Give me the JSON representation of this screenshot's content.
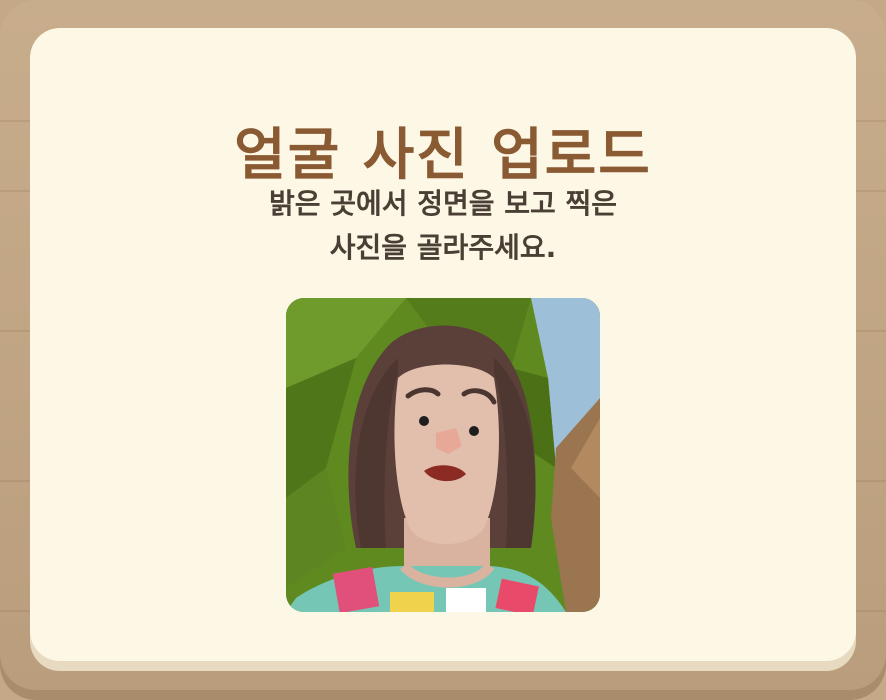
{
  "dialog": {
    "title": "얼굴 사진 업로드",
    "description_line1": "밝은 곳에서 정면을 보고 찍은",
    "description_line2": "사진을 골라주세요."
  },
  "photo": {
    "subject": "avatar-face-photo"
  },
  "colors": {
    "frame": "#c4a887",
    "panel": "#fdf7e6",
    "title": "#8a5a33",
    "text": "#4a3f35"
  }
}
